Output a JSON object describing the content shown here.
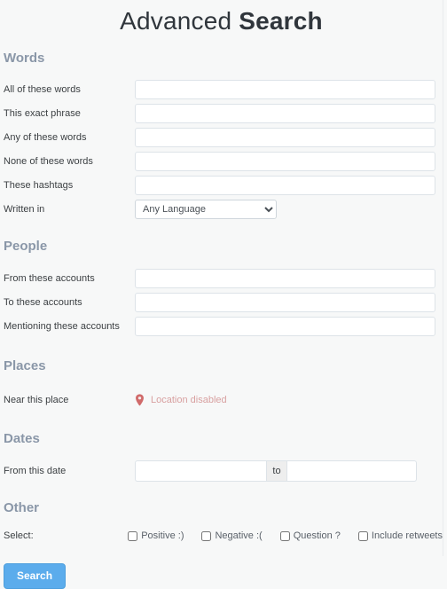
{
  "title": {
    "light": "Advanced ",
    "strong": "Search"
  },
  "sections": {
    "words": {
      "heading": "Words",
      "rows": [
        {
          "label": "All of these words",
          "value": "",
          "placeholder": ""
        },
        {
          "label": "This exact phrase",
          "value": "",
          "placeholder": ""
        },
        {
          "label": "Any of these words",
          "value": "",
          "placeholder": ""
        },
        {
          "label": "None of these words",
          "value": "",
          "placeholder": ""
        },
        {
          "label": "These hashtags",
          "value": "",
          "placeholder": ""
        }
      ],
      "language": {
        "label": "Written in",
        "selected": "Any Language",
        "options": [
          "Any Language"
        ]
      }
    },
    "people": {
      "heading": "People",
      "rows": [
        {
          "label": "From these accounts",
          "value": "",
          "placeholder": ""
        },
        {
          "label": "To these accounts",
          "value": "",
          "placeholder": ""
        },
        {
          "label": "Mentioning these accounts",
          "value": "",
          "placeholder": ""
        }
      ]
    },
    "places": {
      "heading": "Places",
      "label": "Near this place",
      "icon": "map-pin-icon",
      "status": "Location disabled",
      "status_color": "#d8a0a0",
      "icon_color": "#d06a6a"
    },
    "dates": {
      "heading": "Dates",
      "label": "From this date",
      "from_value": "",
      "separator": "to",
      "to_value": ""
    },
    "other": {
      "heading": "Other",
      "label": "Select:",
      "checkboxes": [
        {
          "label": "Positive :)",
          "checked": false
        },
        {
          "label": "Negative :(",
          "checked": false
        },
        {
          "label": "Question ?",
          "checked": false
        },
        {
          "label": "Include retweets",
          "checked": false
        }
      ]
    }
  },
  "submit": {
    "label": "Search",
    "color": "#5bacec"
  }
}
